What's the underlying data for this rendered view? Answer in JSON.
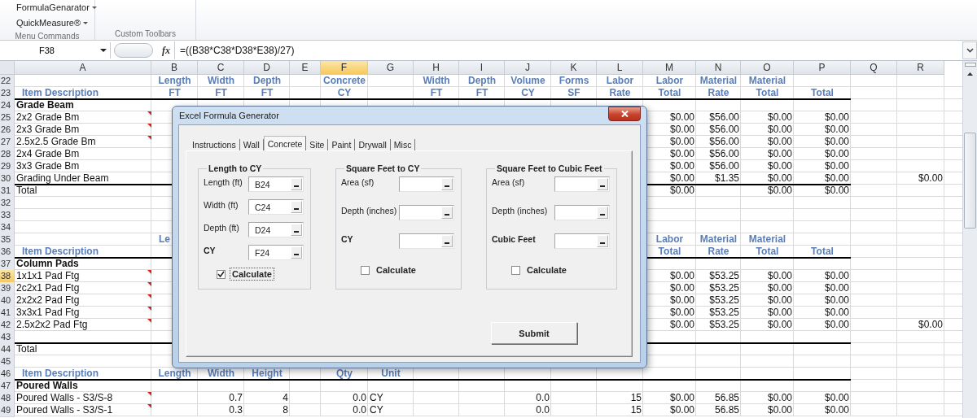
{
  "ribbon": {
    "groups": [
      {
        "label": "Menu Commands",
        "items": [
          {
            "label": "FormulaGenarator"
          },
          {
            "label": "QuickMeasure®"
          }
        ]
      },
      {
        "label": "Custom Toolbars"
      }
    ]
  },
  "formula_bar": {
    "name_box": "F38",
    "function_button": "fx",
    "formula": "=((B38*C38*D38*E38)/27)"
  },
  "columns": [
    {
      "label": "A",
      "selected": false
    },
    {
      "label": "B",
      "selected": false
    },
    {
      "label": "C",
      "selected": false
    },
    {
      "label": "D",
      "selected": false
    },
    {
      "label": "E",
      "selected": false
    },
    {
      "label": "F",
      "selected": true
    },
    {
      "label": "G",
      "selected": false
    },
    {
      "label": "H",
      "selected": false
    },
    {
      "label": "I",
      "selected": false
    },
    {
      "label": "J",
      "selected": false
    },
    {
      "label": "K",
      "selected": false
    },
    {
      "label": "L",
      "selected": false
    },
    {
      "label": "M",
      "selected": false
    },
    {
      "label": "N",
      "selected": false
    },
    {
      "label": "O",
      "selected": false
    },
    {
      "label": "P",
      "selected": false
    },
    {
      "label": "Q",
      "selected": false
    },
    {
      "label": "R",
      "selected": false
    }
  ],
  "rows": [
    {
      "number": "22",
      "selected": false,
      "rule": false,
      "note": false,
      "cells": {
        "B": {
          "text": "Length",
          "kind": "head"
        },
        "C": {
          "text": "Width",
          "kind": "head"
        },
        "D": {
          "text": "Depth",
          "kind": "head"
        },
        "F": {
          "text": "Concrete",
          "kind": "head"
        },
        "H": {
          "text": "Width",
          "kind": "head"
        },
        "I": {
          "text": "Depth",
          "kind": "head"
        },
        "J": {
          "text": "Volume",
          "kind": "head"
        },
        "K": {
          "text": "Forms",
          "kind": "head"
        },
        "L": {
          "text": "Labor",
          "kind": "head"
        },
        "M": {
          "text": "Labor",
          "kind": "head"
        },
        "N": {
          "text": "Material",
          "kind": "head"
        },
        "O": {
          "text": "Material",
          "kind": "head"
        }
      }
    },
    {
      "number": "23",
      "selected": false,
      "rule": true,
      "note": false,
      "cells": {
        "A": {
          "text": "Item Description",
          "kind": "headl"
        },
        "B": {
          "text": "FT",
          "kind": "head"
        },
        "C": {
          "text": "FT",
          "kind": "head"
        },
        "D": {
          "text": "FT",
          "kind": "head"
        },
        "F": {
          "text": "CY",
          "kind": "head"
        },
        "H": {
          "text": "FT",
          "kind": "head"
        },
        "I": {
          "text": "FT",
          "kind": "head"
        },
        "J": {
          "text": "CY",
          "kind": "head"
        },
        "K": {
          "text": "SF",
          "kind": "head"
        },
        "L": {
          "text": "Rate",
          "kind": "head"
        },
        "M": {
          "text": "Total",
          "kind": "head"
        },
        "N": {
          "text": "Rate",
          "kind": "head"
        },
        "O": {
          "text": "Total",
          "kind": "head"
        },
        "P": {
          "text": "Total",
          "kind": "head"
        }
      }
    },
    {
      "number": "24",
      "selected": false,
      "rule": false,
      "note": false,
      "cells": {
        "A": {
          "text": "Grade Beam",
          "kind": "bold"
        }
      }
    },
    {
      "number": "25",
      "selected": false,
      "rule": false,
      "note": true,
      "cells": {
        "A": {
          "text": "2x2 Grade Bm",
          "kind": "text"
        },
        "M": {
          "text": "$0.00",
          "kind": "num"
        },
        "N": {
          "text": "$56.00",
          "kind": "num"
        },
        "O": {
          "text": "$0.00",
          "kind": "num"
        },
        "P": {
          "text": "$0.00",
          "kind": "num"
        }
      }
    },
    {
      "number": "26",
      "selected": false,
      "rule": false,
      "note": true,
      "cells": {
        "A": {
          "text": "2x3 Grade Bm",
          "kind": "text"
        },
        "M": {
          "text": "$0.00",
          "kind": "num"
        },
        "N": {
          "text": "$56.00",
          "kind": "num"
        },
        "O": {
          "text": "$0.00",
          "kind": "num"
        },
        "P": {
          "text": "$0.00",
          "kind": "num"
        }
      }
    },
    {
      "number": "27",
      "selected": false,
      "rule": false,
      "note": true,
      "cells": {
        "A": {
          "text": "2.5x2.5 Grade Bm",
          "kind": "text"
        },
        "M": {
          "text": "$0.00",
          "kind": "num"
        },
        "N": {
          "text": "$56.00",
          "kind": "num"
        },
        "O": {
          "text": "$0.00",
          "kind": "num"
        },
        "P": {
          "text": "$0.00",
          "kind": "num"
        }
      }
    },
    {
      "number": "28",
      "selected": false,
      "rule": false,
      "note": false,
      "cells": {
        "A": {
          "text": "2x4 Grade Bm",
          "kind": "text"
        },
        "M": {
          "text": "$0.00",
          "kind": "num"
        },
        "N": {
          "text": "$56.00",
          "kind": "num"
        },
        "O": {
          "text": "$0.00",
          "kind": "num"
        },
        "P": {
          "text": "$0.00",
          "kind": "num"
        }
      }
    },
    {
      "number": "29",
      "selected": false,
      "rule": false,
      "note": false,
      "cells": {
        "A": {
          "text": "3x3 Grade Bm",
          "kind": "text"
        },
        "M": {
          "text": "$0.00",
          "kind": "num"
        },
        "N": {
          "text": "$56.00",
          "kind": "num"
        },
        "O": {
          "text": "$0.00",
          "kind": "num"
        },
        "P": {
          "text": "$0.00",
          "kind": "num"
        }
      }
    },
    {
      "number": "30",
      "selected": false,
      "rule": true,
      "note": false,
      "cells": {
        "A": {
          "text": "Grading Under Beam",
          "kind": "text"
        },
        "M": {
          "text": "$0.00",
          "kind": "num"
        },
        "N": {
          "text": "$1.35",
          "kind": "num"
        },
        "O": {
          "text": "$0.00",
          "kind": "num"
        },
        "P": {
          "text": "$0.00",
          "kind": "num"
        },
        "R": {
          "text": "$0.00",
          "kind": "num"
        }
      }
    },
    {
      "number": "31",
      "selected": false,
      "rule": false,
      "note": false,
      "cells": {
        "A": {
          "text": "Total",
          "kind": "text"
        },
        "M": {
          "text": "$0.00",
          "kind": "num"
        },
        "O": {
          "text": "$0.00",
          "kind": "num"
        },
        "P": {
          "text": "$0.00",
          "kind": "num"
        }
      }
    },
    {
      "number": "32",
      "selected": false,
      "rule": false,
      "note": false
    },
    {
      "number": "33",
      "selected": false,
      "rule": false,
      "note": false
    },
    {
      "number": "34",
      "selected": false,
      "rule": false,
      "note": false
    },
    {
      "number": "35",
      "selected": false,
      "rule": false,
      "note": false,
      "cells": {
        "B": {
          "text": "Le",
          "kind": "headl"
        },
        "M": {
          "text": "Labor",
          "kind": "head"
        },
        "N": {
          "text": "Material",
          "kind": "head"
        },
        "O": {
          "text": "Material",
          "kind": "head"
        }
      }
    },
    {
      "number": "36",
      "selected": false,
      "rule": true,
      "note": false,
      "cells": {
        "A": {
          "text": "Item Description",
          "kind": "headl"
        },
        "M": {
          "text": "Total",
          "kind": "head"
        },
        "N": {
          "text": "Rate",
          "kind": "head"
        },
        "O": {
          "text": "Total",
          "kind": "head"
        },
        "P": {
          "text": "Total",
          "kind": "head"
        }
      }
    },
    {
      "number": "37",
      "selected": false,
      "rule": false,
      "note": false,
      "cells": {
        "A": {
          "text": "Column Pads",
          "kind": "bold"
        }
      }
    },
    {
      "number": "38",
      "selected": true,
      "rule": false,
      "note": true,
      "cells": {
        "A": {
          "text": "1x1x1 Pad Ftg",
          "kind": "text"
        },
        "M": {
          "text": "$0.00",
          "kind": "num"
        },
        "N": {
          "text": "$53.25",
          "kind": "num"
        },
        "O": {
          "text": "$0.00",
          "kind": "num"
        },
        "P": {
          "text": "$0.00",
          "kind": "num"
        }
      }
    },
    {
      "number": "39",
      "selected": false,
      "rule": false,
      "note": true,
      "cells": {
        "A": {
          "text": "2c2x1 Pad Ftg",
          "kind": "text"
        },
        "M": {
          "text": "$0.00",
          "kind": "num"
        },
        "N": {
          "text": "$53.25",
          "kind": "num"
        },
        "O": {
          "text": "$0.00",
          "kind": "num"
        },
        "P": {
          "text": "$0.00",
          "kind": "num"
        }
      }
    },
    {
      "number": "40",
      "selected": false,
      "rule": false,
      "note": true,
      "cells": {
        "A": {
          "text": "2x2x2 Pad Ftg",
          "kind": "text"
        },
        "M": {
          "text": "$0.00",
          "kind": "num"
        },
        "N": {
          "text": "$53.25",
          "kind": "num"
        },
        "O": {
          "text": "$0.00",
          "kind": "num"
        },
        "P": {
          "text": "$0.00",
          "kind": "num"
        }
      }
    },
    {
      "number": "41",
      "selected": false,
      "rule": false,
      "note": true,
      "cells": {
        "A": {
          "text": "3x3x1 Pad Ftg",
          "kind": "text"
        },
        "M": {
          "text": "$0.00",
          "kind": "num"
        },
        "N": {
          "text": "$53.25",
          "kind": "num"
        },
        "O": {
          "text": "$0.00",
          "kind": "num"
        },
        "P": {
          "text": "$0.00",
          "kind": "num"
        }
      }
    },
    {
      "number": "42",
      "selected": false,
      "rule": false,
      "note": true,
      "cells": {
        "A": {
          "text": "2.5x2x2 Pad Ftg",
          "kind": "text"
        },
        "M": {
          "text": "$0.00",
          "kind": "num"
        },
        "N": {
          "text": "$53.25",
          "kind": "num"
        },
        "O": {
          "text": "$0.00",
          "kind": "num"
        },
        "P": {
          "text": "$0.00",
          "kind": "num"
        },
        "R": {
          "text": "$0.00",
          "kind": "num"
        }
      }
    },
    {
      "number": "43",
      "selected": false,
      "rule": true,
      "note": false
    },
    {
      "number": "44",
      "selected": false,
      "rule": false,
      "note": false,
      "cells": {
        "A": {
          "text": "Total",
          "kind": "text"
        }
      }
    },
    {
      "number": "45",
      "selected": false,
      "rule": false,
      "note": false
    },
    {
      "number": "46",
      "selected": false,
      "rule": true,
      "note": false,
      "cells": {
        "A": {
          "text": "Item Description",
          "kind": "headl"
        },
        "B": {
          "text": "Length",
          "kind": "head"
        },
        "C": {
          "text": "Width",
          "kind": "head"
        },
        "D": {
          "text": "Height",
          "kind": "head"
        },
        "F": {
          "text": "Qty",
          "kind": "head"
        },
        "G": {
          "text": "Unit",
          "kind": "head"
        }
      }
    },
    {
      "number": "47",
      "selected": false,
      "rule": false,
      "note": false,
      "cells": {
        "A": {
          "text": "Poured Walls",
          "kind": "bold"
        }
      }
    },
    {
      "number": "48",
      "selected": false,
      "rule": false,
      "note": true,
      "cells": {
        "A": {
          "text": "Poured Walls - S3/S-8",
          "kind": "text"
        },
        "C": {
          "text": "0.7",
          "kind": "num"
        },
        "D": {
          "text": "4",
          "kind": "num"
        },
        "F": {
          "text": "0.0",
          "kind": "num"
        },
        "G": {
          "text": "CY",
          "kind": "text"
        },
        "J": {
          "text": "0.0",
          "kind": "num"
        },
        "L": {
          "text": "15",
          "kind": "num"
        },
        "M": {
          "text": "$0.00",
          "kind": "num"
        },
        "N": {
          "text": "56.85",
          "kind": "num"
        },
        "O": {
          "text": "$0.00",
          "kind": "num"
        },
        "P": {
          "text": "$0.00",
          "kind": "num"
        }
      }
    },
    {
      "number": "49",
      "selected": false,
      "rule": false,
      "note": true,
      "cells": {
        "A": {
          "text": "Poured Walls - S3/S-1",
          "kind": "text"
        },
        "C": {
          "text": "0.3",
          "kind": "num"
        },
        "D": {
          "text": "8",
          "kind": "num"
        },
        "F": {
          "text": "0.0",
          "kind": "num"
        },
        "G": {
          "text": "CY",
          "kind": "text"
        },
        "J": {
          "text": "0.0",
          "kind": "num"
        },
        "L": {
          "text": "15",
          "kind": "num"
        },
        "M": {
          "text": "$0.00",
          "kind": "num"
        },
        "N": {
          "text": "56.85",
          "kind": "num"
        },
        "O": {
          "text": "$0.00",
          "kind": "num"
        },
        "P": {
          "text": "$0.00",
          "kind": "num"
        }
      }
    }
  ],
  "dialog": {
    "title": "Excel Formula Generator",
    "tabs": [
      {
        "label": "Instructions",
        "selected": false
      },
      {
        "label": "Wall",
        "selected": false
      },
      {
        "label": "Concrete",
        "selected": true
      },
      {
        "label": "Site",
        "selected": false
      },
      {
        "label": "Paint",
        "selected": false
      },
      {
        "label": "Drywall",
        "selected": false
      },
      {
        "label": "Misc",
        "selected": false
      }
    ],
    "groups": [
      {
        "title": "Length to CY",
        "fields": [
          {
            "label": "Length (ft)",
            "value": "B24",
            "kind": "input"
          },
          {
            "label": "Width (ft)",
            "value": "C24",
            "kind": "input"
          },
          {
            "label": "Depth (ft)",
            "value": "D24",
            "kind": "input"
          },
          {
            "label": "CY",
            "value": "F24",
            "kind": "result"
          }
        ],
        "calculate": {
          "label": "Calculate",
          "checked": true,
          "focused": true
        }
      },
      {
        "title": "Square Feet to CY",
        "fields": [
          {
            "label": "Area (sf)",
            "kind": "input"
          },
          {
            "label": "Depth (inches)",
            "kind": "input"
          },
          {
            "label": "CY",
            "kind": "result"
          }
        ],
        "calculate": {
          "label": "Calculate",
          "checked": false,
          "focused": false
        }
      },
      {
        "title": "Square Feet to Cubic Feet",
        "fields": [
          {
            "label": "Area (sf)",
            "kind": "input"
          },
          {
            "label": "Depth (inches)",
            "kind": "input"
          },
          {
            "label": "Cubic Feet",
            "kind": "result"
          }
        ],
        "calculate": {
          "label": "Calculate",
          "checked": false,
          "focused": false
        }
      }
    ],
    "submit": "Submit"
  }
}
